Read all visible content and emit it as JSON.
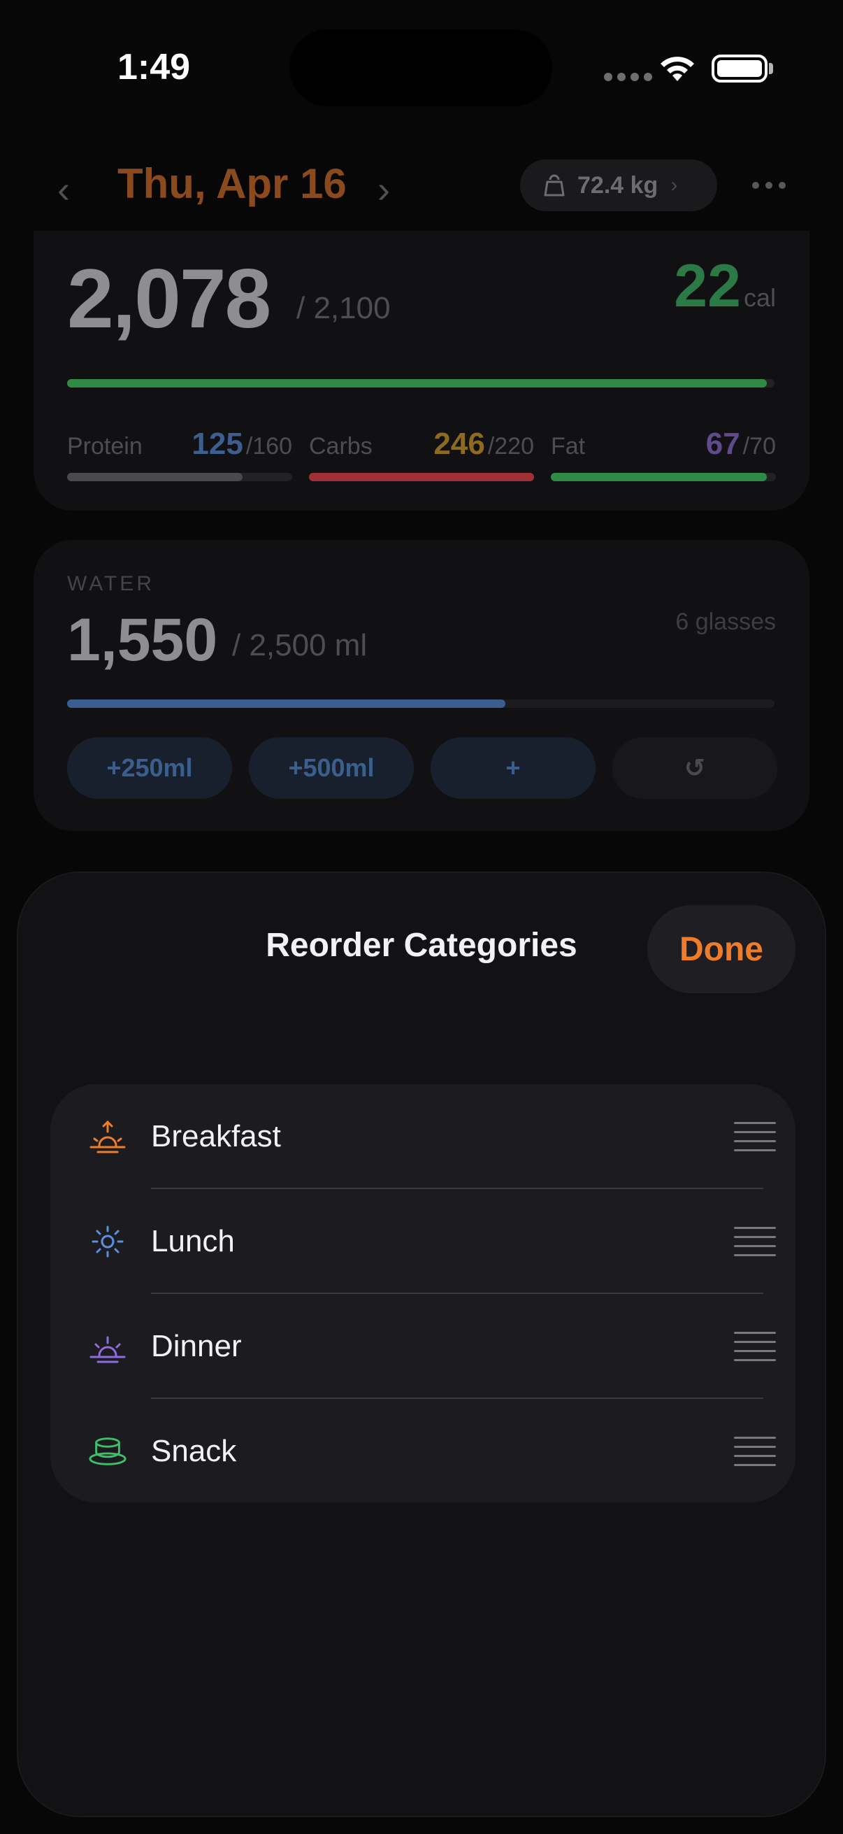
{
  "status": {
    "time": "1:49"
  },
  "header": {
    "date": "Thu, Apr 16",
    "prev_icon": "‹",
    "next_icon": "›",
    "weight": "72.4 kg",
    "weight_chevron": "›"
  },
  "calories": {
    "consumed": "2,078",
    "goal": "/ 2,100",
    "remaining": "22",
    "remaining_unit": "cal",
    "progress": 0.989,
    "macros": [
      {
        "label": "Protein",
        "value": "125",
        "goal": "/160",
        "color": "#3d5f8f",
        "bar_color": "#4a4a4e",
        "progress": 0.78
      },
      {
        "label": "Carbs",
        "value": "246",
        "goal": "/220",
        "color": "#8c6a1e",
        "bar_color": "#a12f35",
        "progress": 1.0
      },
      {
        "label": "Fat",
        "value": "67",
        "goal": "/70",
        "color": "#5f4a8c",
        "bar_color": "#2f8a45",
        "progress": 0.96
      }
    ]
  },
  "water": {
    "label": "WATER",
    "amount": "1,550",
    "goal": "/ 2,500 ml",
    "glasses": "6 glasses",
    "progress": 0.62,
    "buttons": {
      "add_250": "+250ml",
      "add_500": "+500ml",
      "add_custom": "+",
      "undo": "↺"
    }
  },
  "sheet": {
    "title": "Reorder Categories",
    "done_label": "Done",
    "categories": [
      {
        "label": "Breakfast",
        "icon": "sunrise-icon",
        "color": "#f07c2a"
      },
      {
        "label": "Lunch",
        "icon": "sun-icon",
        "color": "#5b8fe0"
      },
      {
        "label": "Dinner",
        "icon": "sunset-icon",
        "color": "#8e6be0"
      },
      {
        "label": "Snack",
        "icon": "cup-icon",
        "color": "#3fbf6a"
      }
    ]
  }
}
